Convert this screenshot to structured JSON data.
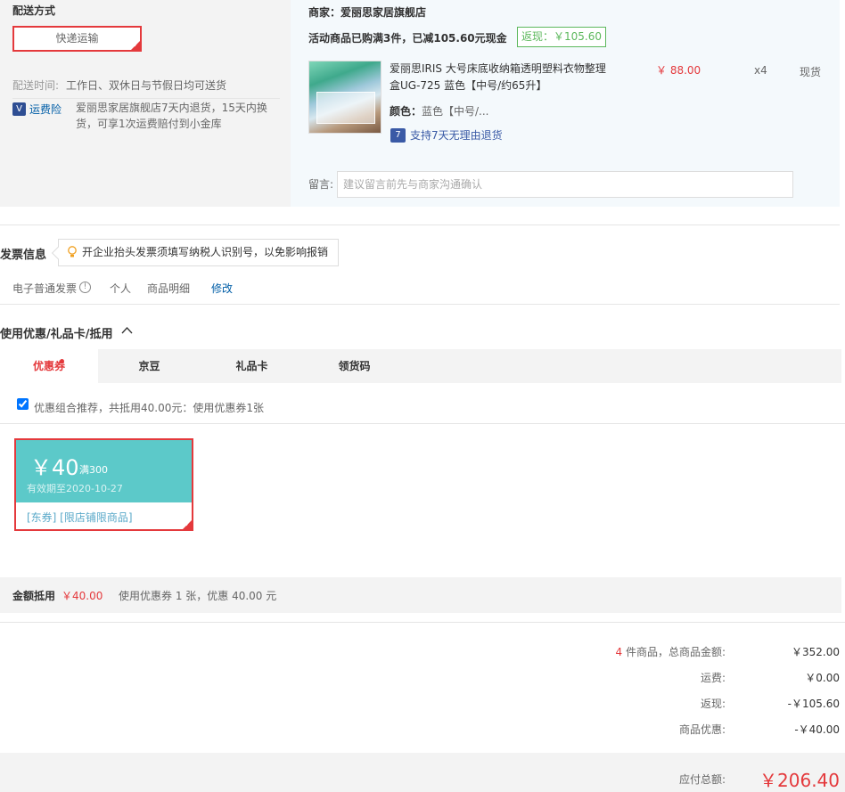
{
  "delivery": {
    "title": "配送方式",
    "method": "快递运输",
    "time_label": "配送时间:",
    "time_value": "工作日、双休日与节假日均可送货",
    "insurance_icon": "V",
    "insurance_link": "运费险",
    "insurance_text": "爱丽思家居旗舰店7天内退货，15天内换货，可享1次运费赔付到小金库"
  },
  "shop": {
    "label": "商家：爱丽思家居旗舰店",
    "promo": "活动商品已购满3件，已减105.60元现金",
    "rebate_tag": "返现：￥105.60",
    "product": {
      "name": "爱丽思IRIS 大号床底收纳箱透明塑料衣物整理盒UG-725 蓝色【中号/约65升】",
      "price": "￥ 88.00",
      "qty": "x4",
      "stock": "现货",
      "color_label": "颜色：",
      "color_value": "蓝色【中号/...",
      "return_icon": "7",
      "return_text": "支持7天无理由退货"
    },
    "message_label": "留言:",
    "message_placeholder": "建议留言前先与商家沟通确认"
  },
  "invoice": {
    "title": "发票信息",
    "tip": "开企业抬头发票须填写纳税人识别号，以免影响报销",
    "type": "电子普通发票",
    "info_icon": "!",
    "person": "个人",
    "detail": "商品明细",
    "edit": "修改"
  },
  "coupons": {
    "title": "使用优惠/礼品卡/抵用",
    "tabs": [
      "优惠券",
      "京豆",
      "礼品卡",
      "领货码"
    ],
    "combo_text": "优惠组合推荐，共抵用40.00元：使用优惠券1张",
    "card": {
      "amount": "￥40",
      "condition": "满300",
      "expiry": "有效期至2020-10-27",
      "tags": "[东券]  [限店铺限商品]"
    },
    "amount_label": "金额抵用",
    "amount_value": "￥40.00",
    "amount_desc": "使用优惠券 1 张，优惠 40.00 元"
  },
  "summary": {
    "count": "4",
    "goods_label": " 件商品，总商品金额:",
    "goods_value": "￥352.00",
    "shipping_label": "运费:",
    "shipping_value": "￥0.00",
    "rebate_label": "返现:",
    "rebate_value": "-￥105.60",
    "discount_label": "商品优惠:",
    "discount_value": "-￥40.00",
    "total_label": "应付总额:",
    "total_value": "￥206.40"
  },
  "colors": {
    "accent": "#e4393c",
    "link": "#005ea7",
    "coupon": "#5cc9c9",
    "rebate": "#5cb85c"
  },
  "icons": [
    "insurance-icon",
    "return-icon",
    "bulb-icon",
    "info-icon",
    "chevron-up-icon",
    "check-icon"
  ]
}
